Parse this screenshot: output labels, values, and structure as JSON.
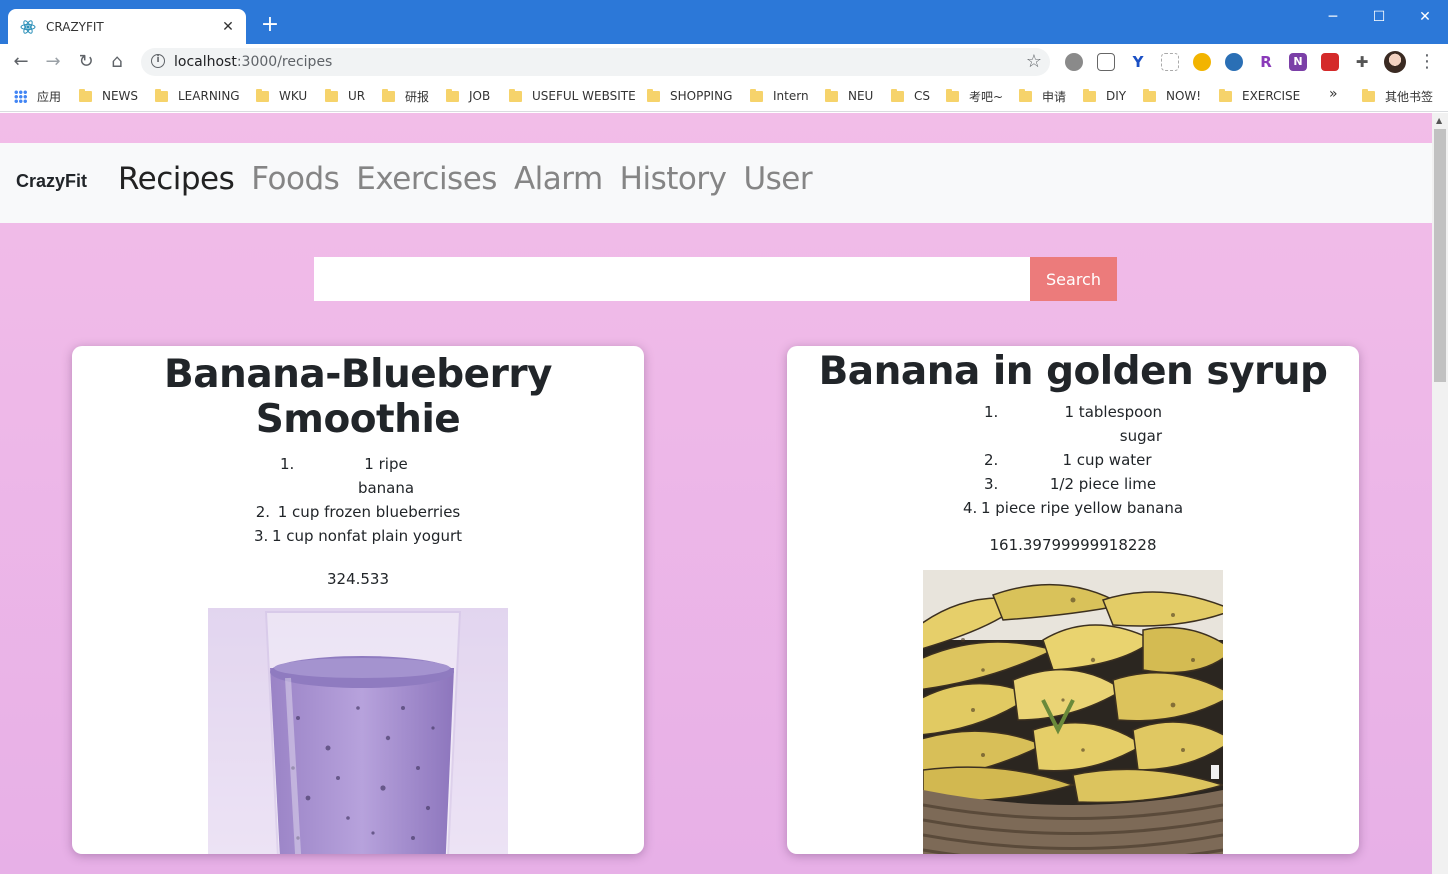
{
  "browser": {
    "tab_title": "CRAZYFIT",
    "url_host": "localhost",
    "url_path": ":3000/recipes",
    "bookmarks": [
      "应用",
      "NEWS",
      "LEARNING",
      "WKU",
      "UR",
      "研报",
      "JOB",
      "USEFUL WEBSITE",
      "SHOPPING",
      "Intern",
      "NEU",
      "CS",
      "考吧~",
      "申请",
      "DIY",
      "NOW!",
      "EXERCISE",
      "其他书签"
    ],
    "overflow_label": "»"
  },
  "app": {
    "brand": "CrazyFit",
    "nav": [
      "Recipes",
      "Foods",
      "Exercises",
      "Alarm",
      "History",
      "User"
    ],
    "active_nav": "Recipes",
    "search": {
      "placeholder": "",
      "button_label": "Search"
    },
    "recipes": [
      {
        "title": "Banana-Blueberry Smoothie",
        "ingredients": [
          "1 ripe banana",
          "1 cup frozen blueberries",
          "1 cup nonfat plain yogurt"
        ],
        "calories": "324.533",
        "image": "smoothie-photo"
      },
      {
        "title": "Banana in golden syrup",
        "ingredients": [
          "1 tablespoon sugar",
          "1 cup water",
          "1/2 piece lime",
          "1 piece ripe yellow banana"
        ],
        "calories": "161.39799999918228",
        "image": "bananas-basket-photo"
      }
    ]
  },
  "colors": {
    "chrome_blue": "#2c78d8",
    "page_bg": "#f2bde8",
    "search_button": "#ec7b7b",
    "navbar_bg": "#f8f9fa"
  }
}
